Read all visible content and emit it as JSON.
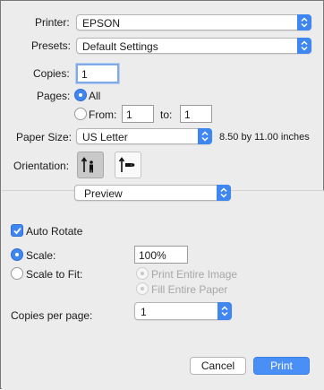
{
  "printer": {
    "label": "Printer:",
    "value": "EPSON"
  },
  "presets": {
    "label": "Presets:",
    "value": "Default Settings"
  },
  "copies": {
    "label": "Copies:",
    "value": "1"
  },
  "pages": {
    "label": "Pages:",
    "all_label": "All",
    "from_label": "From:",
    "from_value": "1",
    "to_label": "to:",
    "to_value": "1",
    "selected": "All"
  },
  "paper_size": {
    "label": "Paper Size:",
    "value": "US Letter",
    "dimensions": "8.50 by 11.00 inches"
  },
  "orientation": {
    "label": "Orientation:",
    "selected": "portrait",
    "icons": [
      "portrait-icon",
      "landscape-icon"
    ]
  },
  "section_popup": {
    "value": "Preview"
  },
  "auto_rotate": {
    "label": "Auto Rotate",
    "checked": true
  },
  "scale": {
    "label": "Scale:",
    "value": "100%",
    "selected": true
  },
  "scale_to_fit": {
    "label": "Scale to Fit:",
    "option_entire_image": "Print Entire Image",
    "option_entire_paper": "Fill Entire Paper",
    "selected": false
  },
  "copies_per_page": {
    "label": "Copies per page:",
    "value": "1"
  },
  "buttons": {
    "cancel": "Cancel",
    "print": "Print"
  },
  "colors": {
    "accent": "#3f86f1",
    "primary_button": "#4a8ff5",
    "background": "#ececec"
  }
}
